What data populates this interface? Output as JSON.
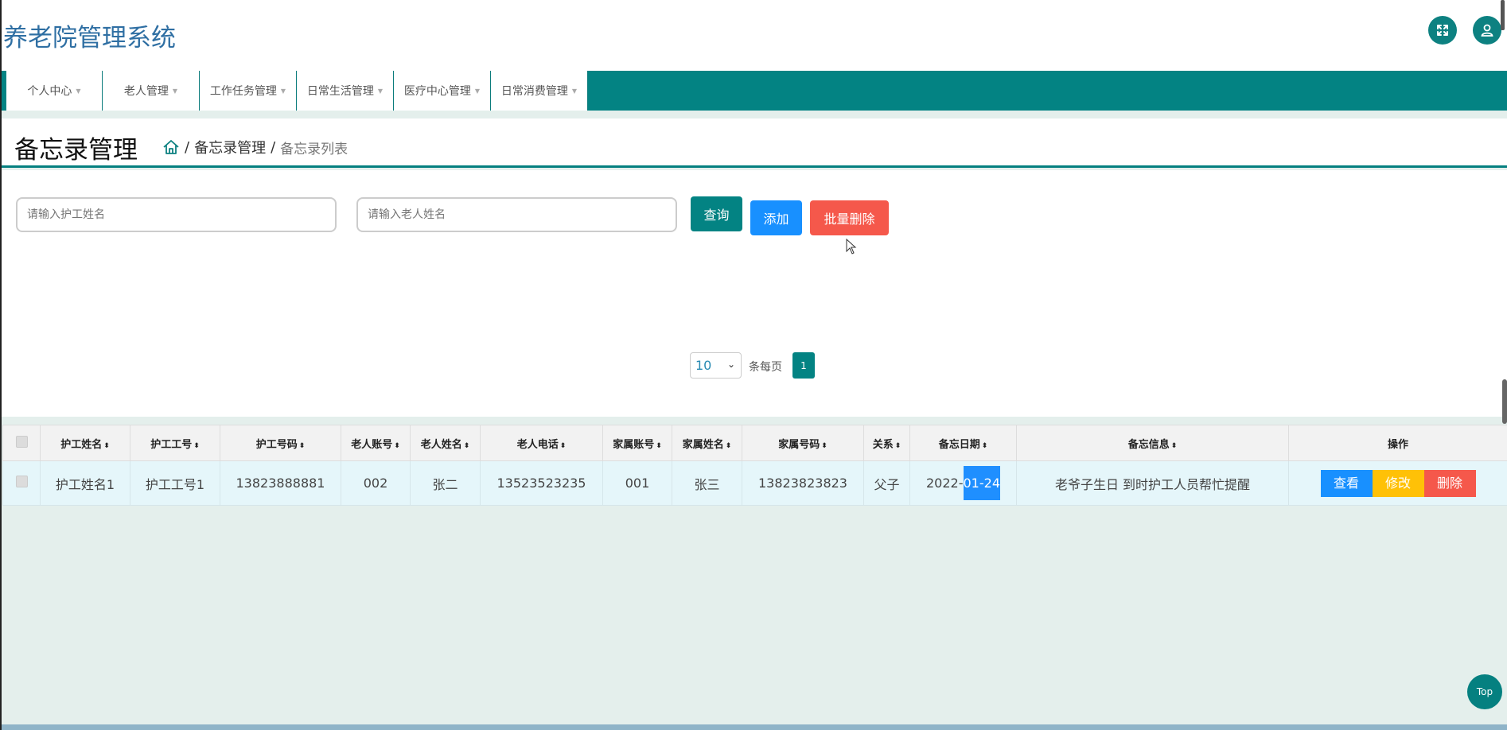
{
  "header": {
    "app_title": "养老院管理系统",
    "fullscreen_icon": "expand-icon",
    "user_icon": "user-icon"
  },
  "nav": {
    "items": [
      {
        "label": "个人中心"
      },
      {
        "label": "老人管理"
      },
      {
        "label": "工作任务管理"
      },
      {
        "label": "日常生活管理"
      },
      {
        "label": "医疗中心管理"
      },
      {
        "label": "日常消费管理"
      }
    ]
  },
  "page": {
    "title": "备忘录管理",
    "breadcrumb": {
      "home_icon": "home-icon",
      "separator": "/",
      "parent": "备忘录管理",
      "current": "备忘录列表"
    }
  },
  "search": {
    "nurse_name_placeholder": "请输入护工姓名",
    "elder_name_placeholder": "请输入老人姓名",
    "query_label": "查询",
    "add_label": "添加",
    "batch_delete_label": "批量删除"
  },
  "table": {
    "sort_glyph": "⬍",
    "columns": [
      "护工姓名",
      "护工工号",
      "护工号码",
      "老人账号",
      "老人姓名",
      "老人电话",
      "家属账号",
      "家属姓名",
      "家属号码",
      "关系",
      "备忘日期",
      "备忘信息"
    ],
    "operation_header": "操作",
    "rows": [
      {
        "nurse_name": "护工姓名1",
        "nurse_id": "护工工号1",
        "nurse_phone": "13823888881",
        "elder_account": "002",
        "elder_name": "张二",
        "elder_phone": "13523523235",
        "family_account": "001",
        "family_name": "张三",
        "family_phone": "13823823823",
        "relation": "父子",
        "memo_date_prefix": "2022-",
        "memo_date_selected": "01-24",
        "memo_info": "老爷子生日 到时护工人员帮忙提醒",
        "view_label": "查看",
        "edit_label": "修改",
        "delete_label": "删除"
      }
    ]
  },
  "pagination": {
    "page_size": "10",
    "per_page_label": "条每页",
    "current_page": "1"
  },
  "top_button": "Top",
  "colors": {
    "primary": "#038383",
    "blue": "#1890ff",
    "danger": "#f5584b",
    "warning": "#ffc107",
    "title_blue": "#2f6fa3"
  }
}
